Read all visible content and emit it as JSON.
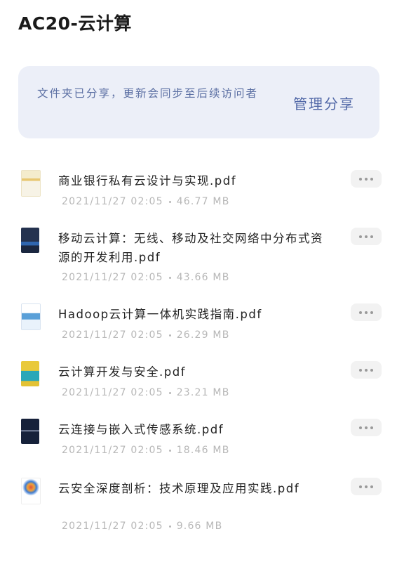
{
  "folder": {
    "title": "AC20-云计算"
  },
  "share_banner": {
    "notice": "文件夹已分享，更新会同步至后续访问者",
    "manage_label": "管理分享"
  },
  "files": [
    {
      "name": "商业银行私有云设计与实现.pdf",
      "date": "2021/11/27 02:05",
      "size": "46.77 MB",
      "thumb_icon": "book-cover-icon"
    },
    {
      "name": "移动云计算：无线、移动及社交网络中分布式资源的开发利用.pdf",
      "date": "2021/11/27 02:05",
      "size": "43.66 MB",
      "thumb_icon": "book-cover-icon"
    },
    {
      "name": "Hadoop云计算一体机实践指南.pdf",
      "date": "2021/11/27 02:05",
      "size": "26.29 MB",
      "thumb_icon": "book-cover-icon"
    },
    {
      "name": "云计算开发与安全.pdf",
      "date": "2021/11/27 02:05",
      "size": "23.21 MB",
      "thumb_icon": "book-cover-icon"
    },
    {
      "name": "云连接与嵌入式传感系统.pdf",
      "date": "2021/11/27 02:05",
      "size": "18.46 MB",
      "thumb_icon": "book-cover-icon"
    },
    {
      "name": "云安全深度剖析：技术原理及应用实践.pdf",
      "date": "2021/11/27 02:05",
      "size": "9.66 MB",
      "thumb_icon": "book-cover-icon"
    }
  ],
  "colors": {
    "banner_bg": "#eceff8",
    "banner_text": "#5b6fa3",
    "meta_text": "#b7b7b7"
  }
}
